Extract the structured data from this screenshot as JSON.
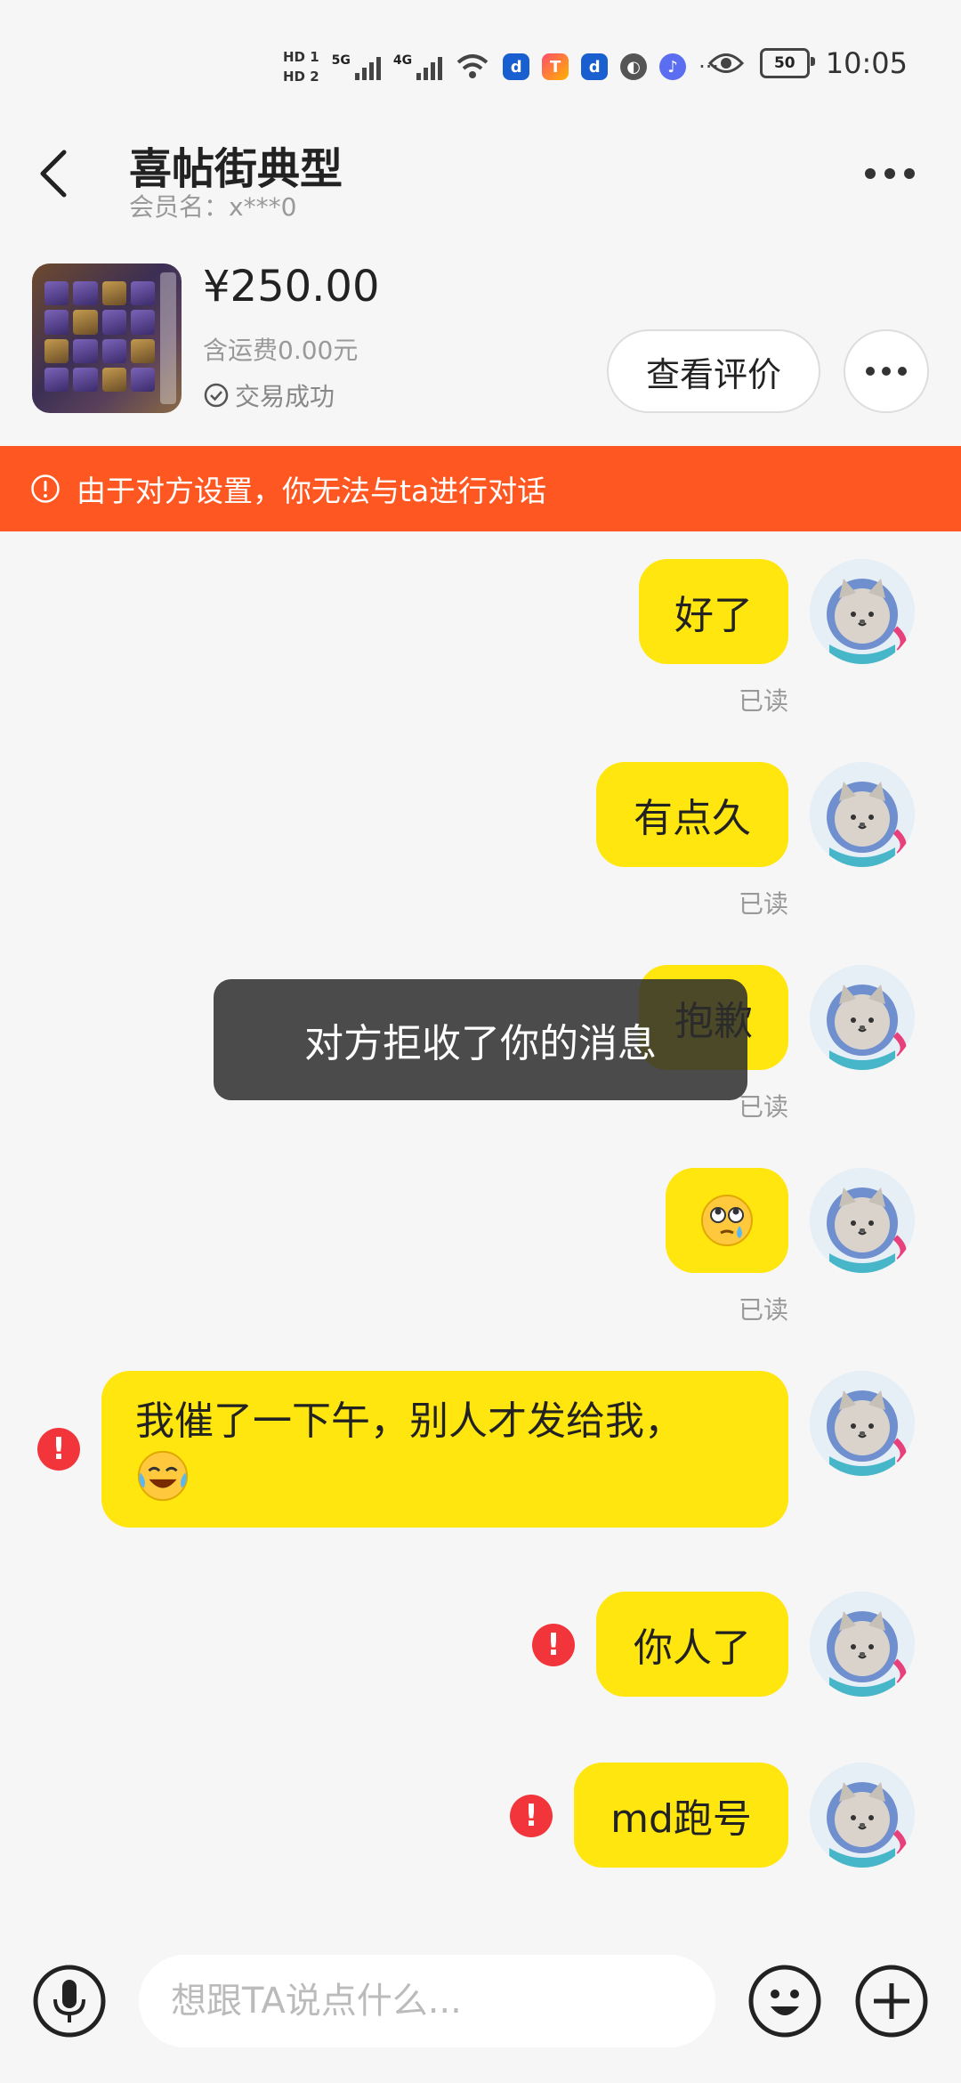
{
  "status_bar": {
    "hd1": "HD 1",
    "hd2": "HD 2",
    "net1": "5G",
    "net2": "4G",
    "battery": "50",
    "time": "10:05"
  },
  "header": {
    "title": "喜帖街典型",
    "subtitle": "会员名：x***0"
  },
  "product": {
    "price": "¥250.00",
    "shipping": "含运费0.00元",
    "status": "交易成功",
    "review_button": "查看评价"
  },
  "banner": {
    "text": "由于对方设置，你无法与ta进行对话"
  },
  "messages": [
    {
      "text": "好了",
      "read": "已读"
    },
    {
      "text": "有点久",
      "read": "已读"
    },
    {
      "text": "抱歉",
      "read": "已读"
    },
    {
      "emoji": "eye-roll-tear-emoji",
      "read": "已读"
    },
    {
      "text": "我催了一下午，别人才发给我，",
      "emoji": "laugh-cry-emoji",
      "failed": true
    },
    {
      "text": "你人了",
      "failed": true
    },
    {
      "text": "md跑号",
      "failed": true
    }
  ],
  "toast": {
    "text": "对方拒收了你的消息"
  },
  "input": {
    "placeholder": "想跟TA说点什么..."
  },
  "colors": {
    "bubble": "#ffe60f",
    "banner": "#ff5722",
    "error": "#f2353b",
    "background": "#f6f6f6"
  }
}
